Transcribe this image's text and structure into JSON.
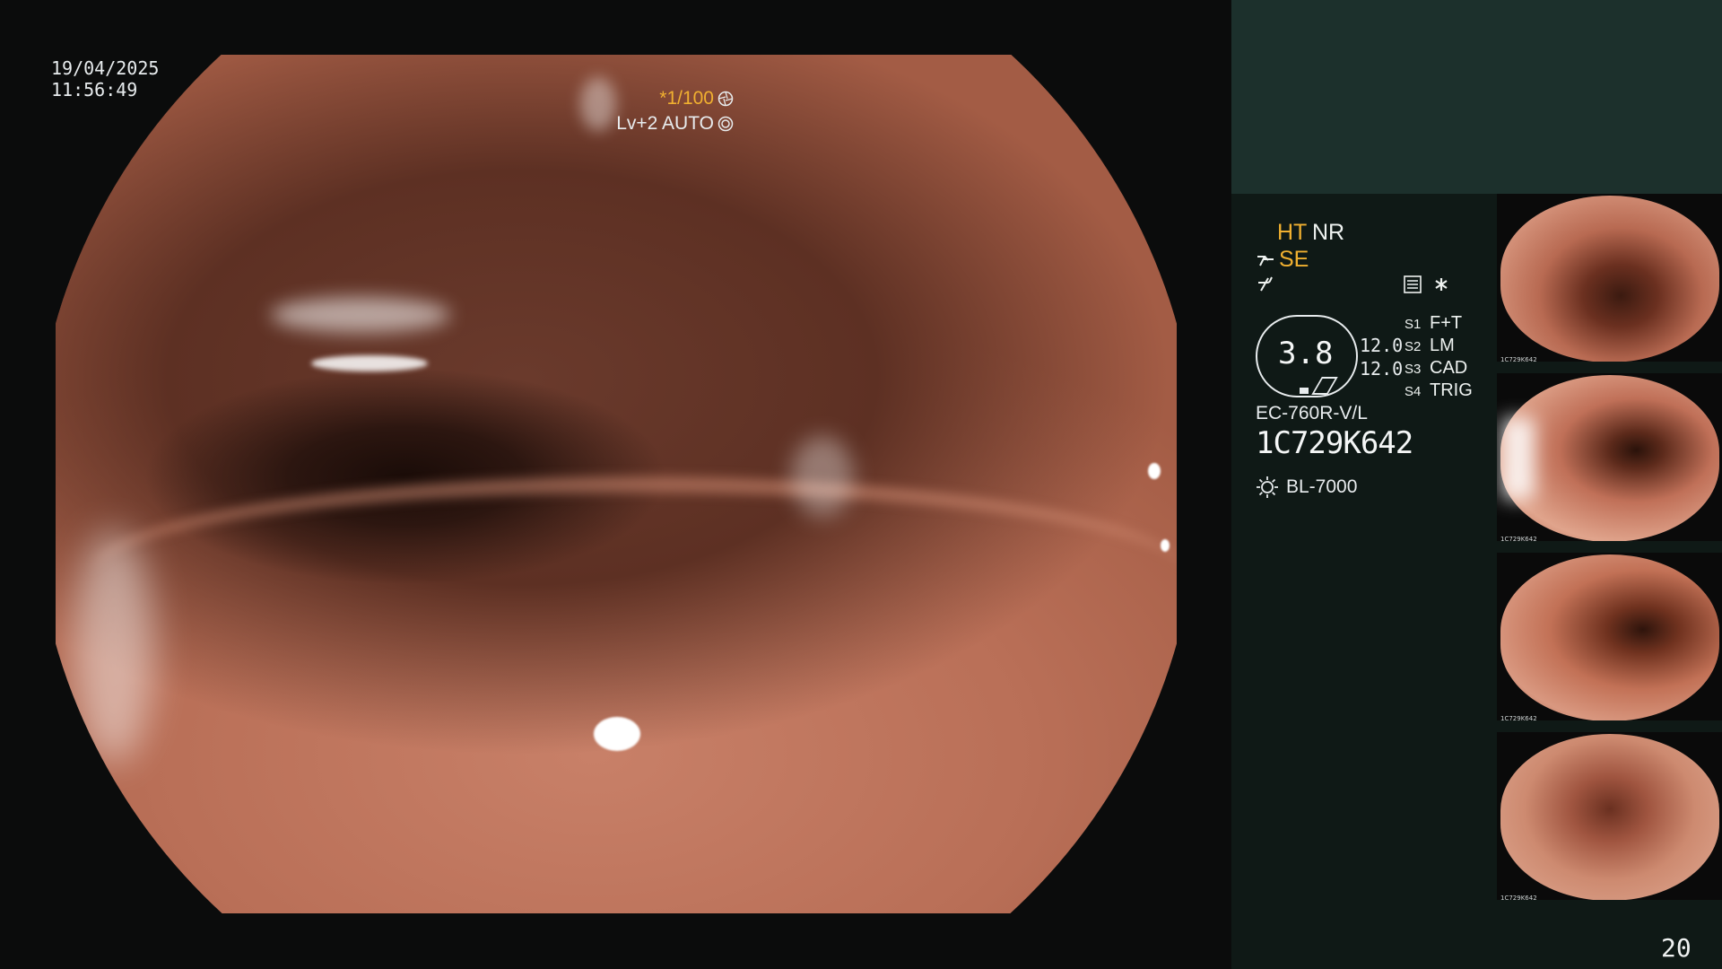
{
  "main": {
    "date": "19/04/2025",
    "time": "11:56:49",
    "shutter": "*1/100",
    "iris": "Lv+2 AUTO"
  },
  "panel": {
    "ht": "HT",
    "nr": "NR",
    "se": "SE",
    "scope_value": "3.8",
    "dim_a": "12.0",
    "dim_b": "12.0",
    "switches": [
      {
        "key": "S1",
        "value": "F+T"
      },
      {
        "key": "S2",
        "value": "LM"
      },
      {
        "key": "S3",
        "value": "CAD"
      },
      {
        "key": "S4",
        "value": "TRIG"
      }
    ],
    "scope_model": "EC-760R-V/L",
    "scope_serial": "1C729K642",
    "light_source": "BL-7000",
    "frame_count": "20"
  },
  "thumbnails": [
    {
      "label": "1C729K642"
    },
    {
      "label": "1C729K642"
    },
    {
      "label": "1C729K642"
    },
    {
      "label": "1C729K642"
    }
  ],
  "icons": {
    "shutter": "aperture-icon",
    "iris": "iris-icon",
    "se": "structure-enhance-icon",
    "tone": "tone-curve-icon",
    "menu": "menu-list-icon",
    "star": "asterisk-icon",
    "light": "sun-icon"
  },
  "colors": {
    "accent": "#f0b030",
    "panel_bg": "#0f1916",
    "panel_top": "#1c302c",
    "text": "#e8ecee"
  }
}
